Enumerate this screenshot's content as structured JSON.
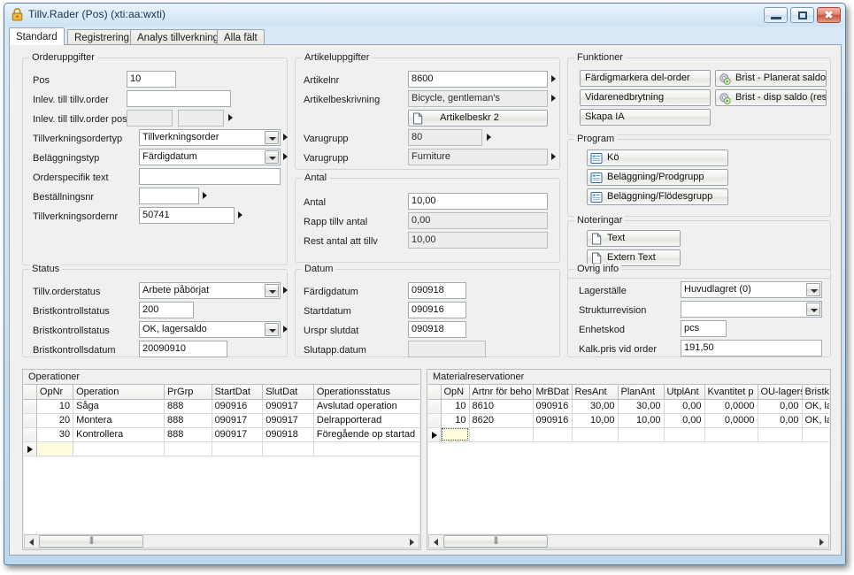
{
  "window": {
    "title": "Tillv.Rader (Pos) (xti:aa:wxti)",
    "lock_icon": "lock-icon",
    "minimize_label": "",
    "maximize_label": "",
    "close_label": "✖"
  },
  "tabs": [
    {
      "label": "Standard",
      "active": true
    },
    {
      "label": "Registrering",
      "active": false
    },
    {
      "label": "Analys tillverkning",
      "active": false
    },
    {
      "label": "Alla fält",
      "active": false
    }
  ],
  "groups": {
    "orderuppgifter": {
      "title": "Orderuppgifter",
      "fields": [
        {
          "label": "Pos",
          "value": "10",
          "type": "text",
          "readonly": false
        },
        {
          "label": "Inlev. till tillv.order",
          "value": "",
          "type": "text",
          "readonly": false
        },
        {
          "label": "Inlev. till tillv.order pos",
          "value": "",
          "value2": "",
          "type": "dual",
          "readonly": true
        },
        {
          "label": "Tillverkningsordertyp",
          "value": "Tillverkningsorder",
          "type": "combo",
          "readonly": false
        },
        {
          "label": "Beläggningstyp",
          "value": "Färdigdatum",
          "type": "combo",
          "readonly": false
        },
        {
          "label": "Orderspecifik text",
          "value": "",
          "type": "text",
          "readonly": false
        },
        {
          "label": "Beställningsnr",
          "value": "",
          "type": "picker",
          "readonly": false
        },
        {
          "label": "Tillverkningsordernr",
          "value": "50741",
          "type": "picker",
          "readonly": false
        }
      ]
    },
    "status": {
      "title": "Status",
      "fields": [
        {
          "label": "Tillv.orderstatus",
          "value": "Arbete påbörjat",
          "type": "combo"
        },
        {
          "label": "Bristkontrollstatus",
          "value": "200",
          "type": "text"
        },
        {
          "label": "Bristkontrollstatus",
          "value": "OK, lagersaldo",
          "type": "combo"
        },
        {
          "label": "Bristkontrollsdatum",
          "value": "20090910",
          "type": "text"
        }
      ]
    },
    "artikeluppgifter": {
      "title": "Artikeluppgifter",
      "fields": [
        {
          "label": "Artikelnr",
          "value": "8600",
          "type": "picker",
          "readonly": false
        },
        {
          "label": "Artikelbeskrivning",
          "value": "Bicycle, gentleman's",
          "type": "picker",
          "readonly": true
        },
        {
          "label": "Varugrupp",
          "value": "80",
          "type": "picker",
          "readonly": true
        },
        {
          "label": "Varugrupp",
          "value": "Furniture",
          "type": "picker",
          "readonly": true
        }
      ],
      "button": {
        "label": "Artikelbeskr 2",
        "icon": "document-icon"
      }
    },
    "antal": {
      "title": "Antal",
      "fields": [
        {
          "label": "Antal",
          "value": "10,00",
          "readonly": false
        },
        {
          "label": "Rapp tillv antal",
          "value": "0,00",
          "readonly": true
        },
        {
          "label": "Rest antal att tillv",
          "value": "10,00",
          "readonly": true
        }
      ]
    },
    "datum": {
      "title": "Datum",
      "fields": [
        {
          "label": "Färdigdatum",
          "value": "090918",
          "readonly": false
        },
        {
          "label": "Startdatum",
          "value": "090916",
          "readonly": false
        },
        {
          "label": "Urspr slutdat",
          "value": "090918",
          "readonly": false
        },
        {
          "label": "Slutapp.datum",
          "value": "",
          "readonly": true
        }
      ]
    },
    "funktioner": {
      "title": "Funktioner",
      "buttons_left": [
        {
          "label": "Färdigmarkera del-order",
          "icon": null
        },
        {
          "label": "Vidarenedbrytning",
          "icon": null
        },
        {
          "label": "Skapa IA",
          "icon": null
        }
      ],
      "buttons_right": [
        {
          "label": "Brist - Planerat saldo",
          "icon": "gear-run-icon"
        },
        {
          "label": "Brist - disp saldo (res)",
          "icon": "gear-run-icon"
        }
      ]
    },
    "program": {
      "title": "Program",
      "buttons": [
        {
          "label": "Kö",
          "icon": "list-window-icon"
        },
        {
          "label": "Beläggning/Prodgrupp",
          "icon": "list-window-icon"
        },
        {
          "label": "Beläggning/Flödesgrupp",
          "icon": "list-window-icon"
        }
      ]
    },
    "noteringar": {
      "title": "Noteringar",
      "buttons": [
        {
          "label": "Text",
          "icon": "document-icon"
        },
        {
          "label": "Extern Text",
          "icon": "document-icon"
        }
      ]
    },
    "ovrig_info": {
      "title": "Ovrig info",
      "fields": [
        {
          "label": "Lagerställe",
          "value": "Huvudlagret (0)",
          "type": "combo"
        },
        {
          "label": "Strukturrevision",
          "value": "",
          "type": "combo"
        },
        {
          "label": "Enhetskod",
          "value": "pcs",
          "type": "text"
        },
        {
          "label": "Kalk.pris vid order",
          "value": "191,50",
          "type": "text"
        }
      ]
    }
  },
  "operationer": {
    "caption": "Operationer",
    "columns": [
      "OpNr",
      "Operation",
      "PrGrp",
      "StartDat",
      "SlutDat",
      "Operationsstatus"
    ],
    "rows": [
      {
        "opnr": "10",
        "operation": "Såga",
        "prgrp": "888",
        "startdat": "090916",
        "slutdat": "090917",
        "status": "Avslutad operation",
        "status_color": "#1a7d27"
      },
      {
        "opnr": "20",
        "operation": "Montera",
        "prgrp": "888",
        "startdat": "090917",
        "slutdat": "090917",
        "status": "Delrapporterad",
        "status_color": "#1a7d27"
      },
      {
        "opnr": "30",
        "operation": "Kontrollera",
        "prgrp": "888",
        "startdat": "090917",
        "slutdat": "090918",
        "status": "Föregående op startad",
        "status_color": "#111111"
      }
    ]
  },
  "materialreservationer": {
    "caption": "Materialreservationer",
    "columns": [
      "OpN",
      "Artnr för beho",
      "MrBDat",
      "ResAnt",
      "PlanAnt",
      "UtplAnt",
      "Kvantitet p",
      "OU-lagersä",
      "Bristkontr"
    ],
    "rows": [
      {
        "opn": "10",
        "artnr": "8610",
        "mrbdat": "090916",
        "resant": "30,00",
        "planant": "30,00",
        "utplant": "0,00",
        "kvantitet": "0,0000",
        "oulager": "0,00",
        "brist": "OK, lager"
      },
      {
        "opn": "10",
        "artnr": "8620",
        "mrbdat": "090916",
        "resant": "10,00",
        "planant": "10,00",
        "utplant": "0,00",
        "kvantitet": "0,0000",
        "oulager": "0,00",
        "brist": "OK, lager"
      }
    ]
  },
  "colors": {
    "accent_green": "#1a7d27",
    "titlebar": "#dbebf8",
    "panel_bg": "#f0f0ee",
    "border": "#9aa3ab"
  }
}
